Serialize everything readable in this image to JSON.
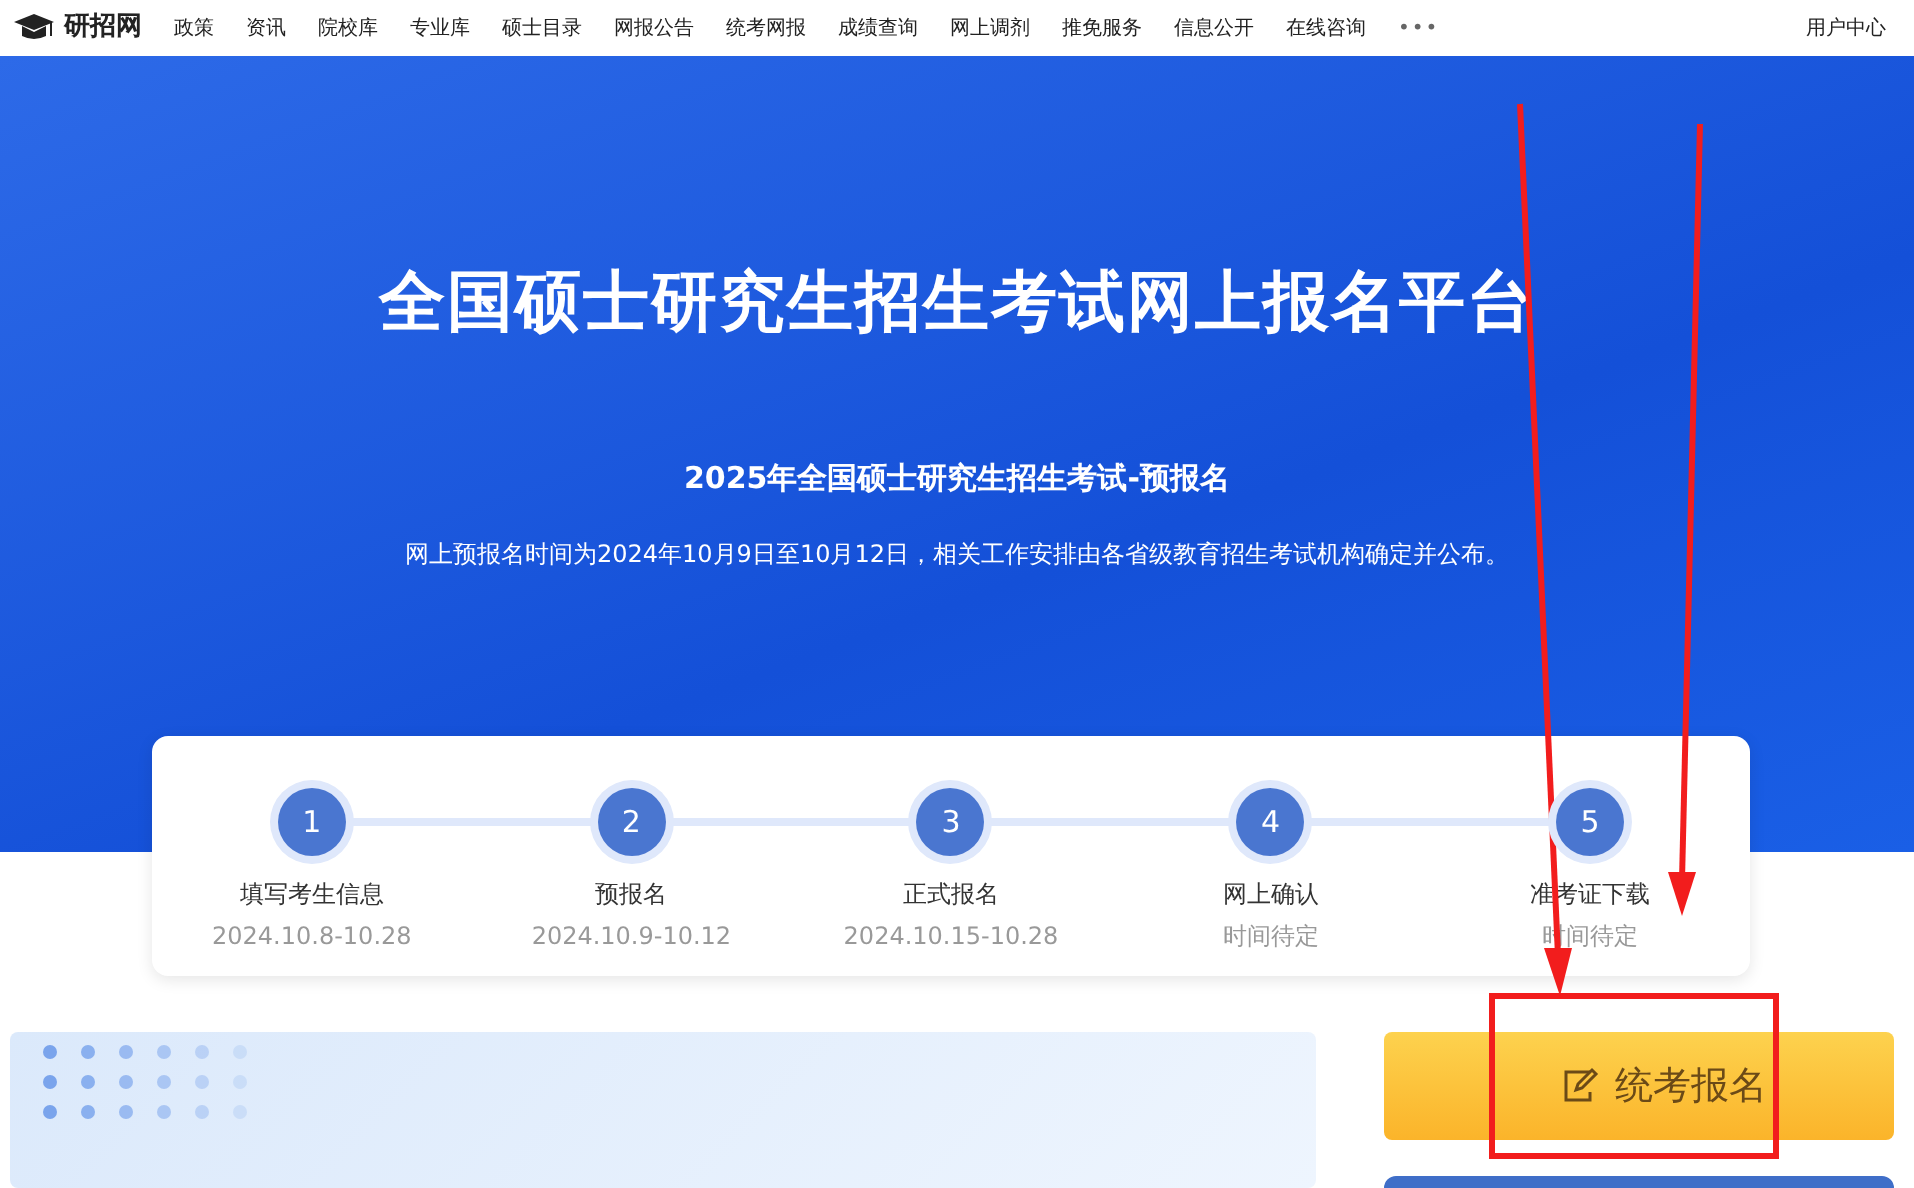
{
  "navbar": {
    "logo": "研招网",
    "items": [
      "政策",
      "资讯",
      "院校库",
      "专业库",
      "硕士目录",
      "网报公告",
      "统考网报",
      "成绩查询",
      "网上调剂",
      "推免服务",
      "信息公开",
      "在线咨询"
    ],
    "more": "•••",
    "user": "用户中心"
  },
  "hero": {
    "title": "全国硕士研究生招生考试网上报名平台",
    "subtitle": "2025年全国硕士研究生招生考试-预报名",
    "description": "网上预报名时间为2024年10月9日至10月12日，相关工作安排由各省级教育招生考试机构确定并公布。"
  },
  "steps": [
    {
      "number": "1",
      "label": "填写考生信息",
      "date": "2024.10.8-10.28"
    },
    {
      "number": "2",
      "label": "预报名",
      "date": "2024.10.9-10.12"
    },
    {
      "number": "3",
      "label": "正式报名",
      "date": "2024.10.15-10.28"
    },
    {
      "number": "4",
      "label": "网上确认",
      "date": "时间待定"
    },
    {
      "number": "5",
      "label": "准考证下载",
      "date": "时间待定"
    }
  ],
  "register_button": {
    "label": "统考报名"
  }
}
